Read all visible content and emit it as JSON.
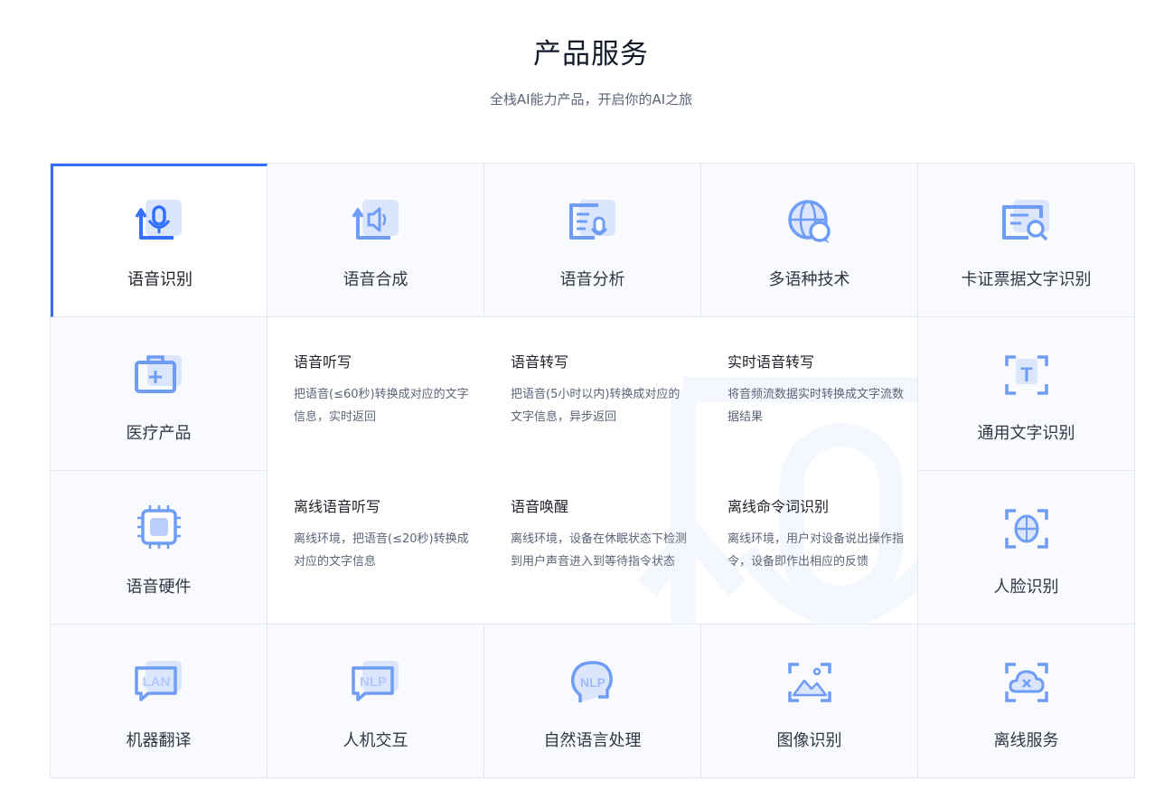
{
  "header": {
    "title": "产品服务",
    "subtitle": "全栈AI能力产品，开启你的AI之旅"
  },
  "products": {
    "speech_recognition": {
      "label": "语音识别",
      "icon": "microphone-icon"
    },
    "speech_synthesis": {
      "label": "语音合成",
      "icon": "speaker-icon"
    },
    "speech_analysis": {
      "label": "语音分析",
      "icon": "speech-analysis-icon"
    },
    "multilingual": {
      "label": "多语种技术",
      "icon": "globe-chat-icon"
    },
    "card_ocr": {
      "label": "卡证票据文字识别",
      "icon": "card-search-icon"
    },
    "medical": {
      "label": "医疗产品",
      "icon": "medical-kit-icon"
    },
    "general_ocr": {
      "label": "通用文字识别",
      "icon": "text-scan-icon",
      "glyph": "T"
    },
    "speech_hardware": {
      "label": "语音硬件",
      "icon": "chip-icon"
    },
    "face": {
      "label": "人脸识别",
      "icon": "face-scan-icon"
    },
    "machine_translation": {
      "label": "机器翻译",
      "icon": "lan-chat-icon",
      "glyph": "LAN"
    },
    "hci": {
      "label": "人机交互",
      "icon": "nlp-chat-icon",
      "glyph": "NLP"
    },
    "nlp": {
      "label": "自然语言处理",
      "icon": "nlp-head-icon",
      "glyph": "NLP"
    },
    "image": {
      "label": "图像识别",
      "icon": "image-scan-icon"
    },
    "offline": {
      "label": "离线服务",
      "icon": "cloud-offline-icon"
    }
  },
  "detail": {
    "items": [
      {
        "title": "语音听写",
        "desc": "把语音(≤60秒)转换成对应的文字信息，实时返回"
      },
      {
        "title": "语音转写",
        "desc": "把语音(5小时以内)转换成对应的文字信息，异步返回"
      },
      {
        "title": "实时语音转写",
        "desc": "将音频流数据实时转换成文字流数据结果"
      },
      {
        "title": "离线语音听写",
        "desc": "离线环境，把语音(≤20秒)转换成对应的文字信息"
      },
      {
        "title": "语音唤醒",
        "desc": "离线环境，设备在休眠状态下检测到用户声音进入到等待指令状态"
      },
      {
        "title": "离线命令词识别",
        "desc": "离线环境，用户对设备说出操作指令，设备即作出相应的反馈"
      }
    ]
  },
  "colors": {
    "accent": "#3370ff",
    "icon_main": "#6f9df6",
    "icon_light": "#dbe6fd",
    "cell_bg": "#f8fafd",
    "border": "#e4e8ef"
  }
}
